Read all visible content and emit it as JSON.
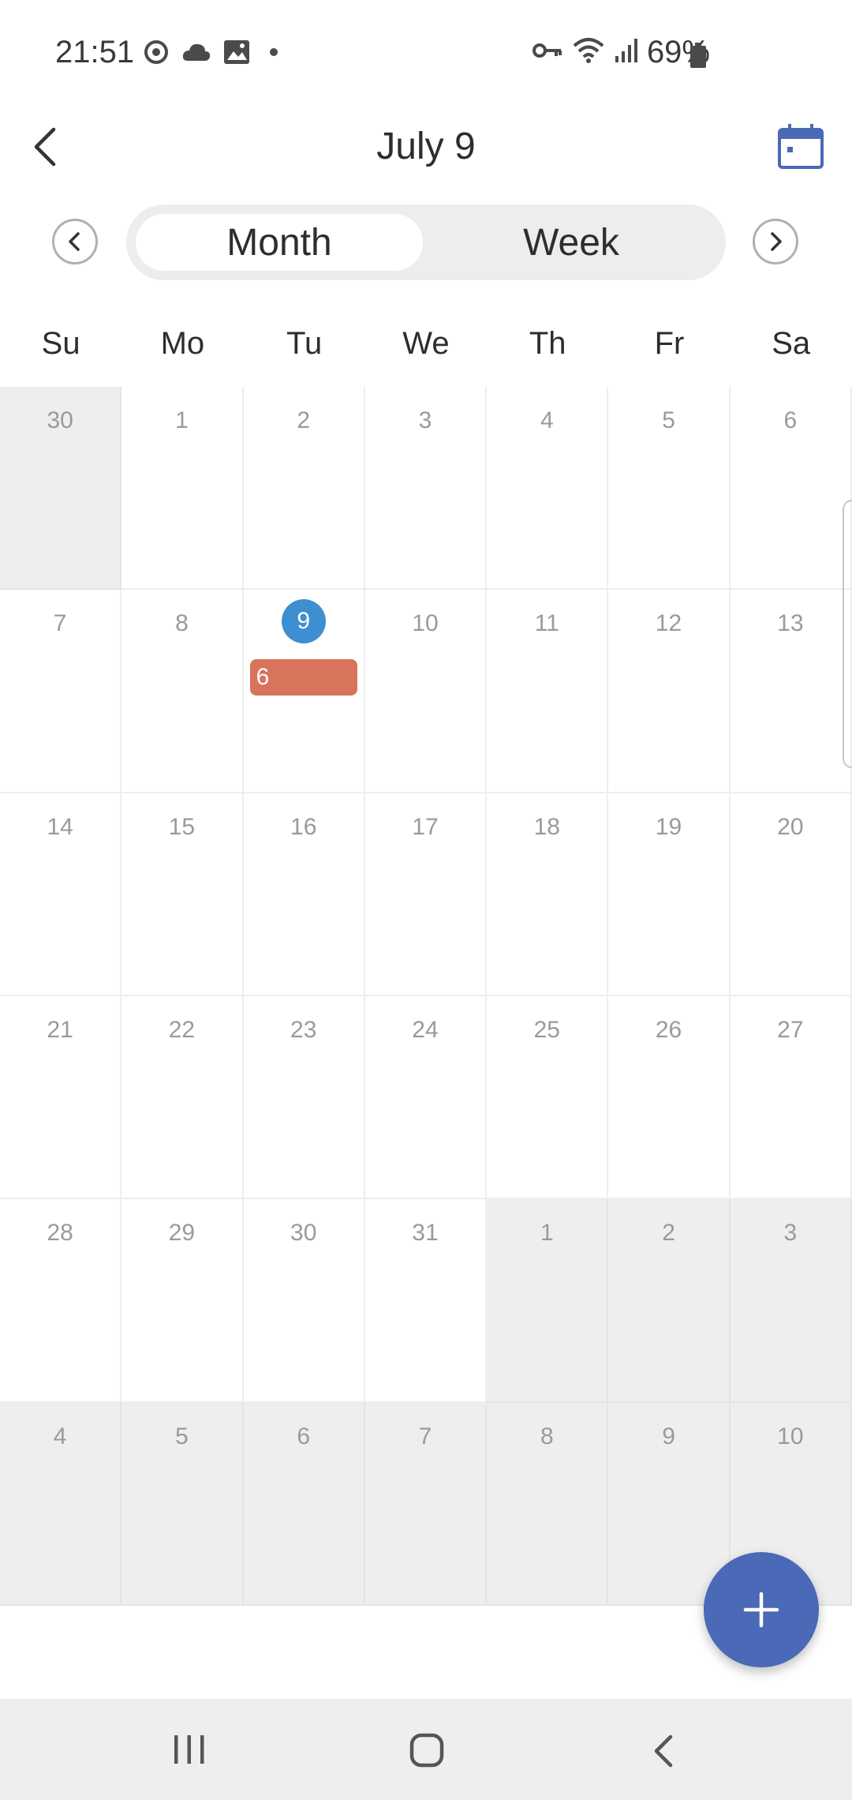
{
  "status_bar": {
    "time": "21:51",
    "battery": "69%"
  },
  "header": {
    "title": "July 9"
  },
  "view_switcher": {
    "month_label": "Month",
    "week_label": "Week",
    "selected": "Month"
  },
  "weekdays": [
    "Su",
    "Mo",
    "Tu",
    "We",
    "Th",
    "Fr",
    "Sa"
  ],
  "weeks": [
    [
      {
        "day": "30",
        "out": true
      },
      {
        "day": "1"
      },
      {
        "day": "2"
      },
      {
        "day": "3"
      },
      {
        "day": "4"
      },
      {
        "day": "5"
      },
      {
        "day": "6"
      }
    ],
    [
      {
        "day": "7"
      },
      {
        "day": "8"
      },
      {
        "day": "9",
        "today": true,
        "event": "6"
      },
      {
        "day": "10"
      },
      {
        "day": "11"
      },
      {
        "day": "12"
      },
      {
        "day": "13"
      }
    ],
    [
      {
        "day": "14"
      },
      {
        "day": "15"
      },
      {
        "day": "16"
      },
      {
        "day": "17"
      },
      {
        "day": "18"
      },
      {
        "day": "19"
      },
      {
        "day": "20"
      }
    ],
    [
      {
        "day": "21"
      },
      {
        "day": "22"
      },
      {
        "day": "23"
      },
      {
        "day": "24"
      },
      {
        "day": "25"
      },
      {
        "day": "26"
      },
      {
        "day": "27"
      }
    ],
    [
      {
        "day": "28"
      },
      {
        "day": "29"
      },
      {
        "day": "30"
      },
      {
        "day": "31"
      },
      {
        "day": "1",
        "out": true
      },
      {
        "day": "2",
        "out": true
      },
      {
        "day": "3",
        "out": true
      }
    ],
    [
      {
        "day": "4",
        "out": true
      },
      {
        "day": "5",
        "out": true
      },
      {
        "day": "6",
        "out": true
      },
      {
        "day": "7",
        "out": true
      },
      {
        "day": "8",
        "out": true
      },
      {
        "day": "9",
        "out": true
      },
      {
        "day": "10",
        "out": true
      }
    ]
  ],
  "colors": {
    "accent": "#4a69b6",
    "today": "#3d8fd1",
    "event": "#d8735c",
    "out_of_month": "#eeeeee"
  },
  "icons": [
    "sync-icon",
    "cloud-icon",
    "gallery-icon",
    "key-icon",
    "wifi-icon",
    "signal-icon",
    "battery-icon",
    "back-arrow-icon",
    "calendar-icon",
    "chevron-left-icon",
    "chevron-right-icon",
    "plus-icon",
    "recents-icon",
    "home-icon",
    "nav-back-icon"
  ]
}
